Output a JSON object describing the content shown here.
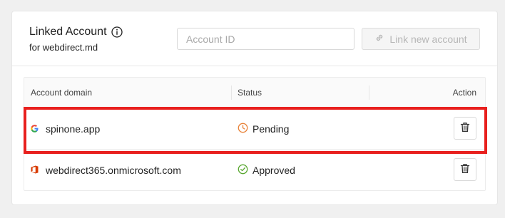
{
  "header": {
    "title": "Linked Account",
    "subtitle": "for webdirect.md"
  },
  "account_input": {
    "placeholder": "Account ID",
    "value": ""
  },
  "link_button": {
    "label": "Link new account",
    "state": "disabled"
  },
  "table": {
    "columns": [
      "Account domain",
      "Status",
      "Action"
    ],
    "rows": [
      {
        "provider_icon": "google-icon",
        "domain": "spinone.app",
        "status": "Pending",
        "status_icon": "clock-icon",
        "status_color": "#e8833a",
        "highlighted": true
      },
      {
        "provider_icon": "microsoft-office-icon",
        "domain": "webdirect365.onmicrosoft.com",
        "status": "Approved",
        "status_icon": "check-circle-icon",
        "status_color": "#5aa832",
        "highlighted": false
      }
    ]
  },
  "colors": {
    "highlight": "#e8201e",
    "pending": "#e8833a",
    "approved": "#5aa832"
  }
}
